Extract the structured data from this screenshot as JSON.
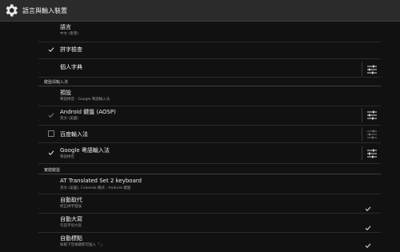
{
  "titlebar": {
    "title": "語言與輸入裝置"
  },
  "items": {
    "language": {
      "title": "語言",
      "subtitle": "中文 (香港)"
    },
    "spell": {
      "title": "拼字檢查"
    },
    "dict": {
      "title": "個人字典"
    },
    "default": {
      "title": "預設",
      "subtitle": "粵語拼音 - Google 粵語輸入法"
    },
    "aosp": {
      "title": "Android 鍵盤 (AOSP)",
      "subtitle": "英文 (美國)"
    },
    "baidu": {
      "title": "百度輸入法"
    },
    "google": {
      "title": "Google 粵語輸入法",
      "subtitle": "粵語拼音"
    },
    "at": {
      "title": "AT Translated Set 2 keyboard",
      "subtitle": "英文 (美國), Colemak 模式 - Android 鍵盤"
    },
    "autoreplace": {
      "title": "自動取代",
      "subtitle": "修正拼字錯誤"
    },
    "autocap": {
      "title": "自動大寫",
      "subtitle": "句首字母大寫"
    },
    "autopunct": {
      "title": "自動標點",
      "subtitle": "按兩下空格鍵即可插入「.」"
    }
  },
  "sections": {
    "keyboard": "鍵盤與輸入法",
    "physical": "實體鍵盤"
  },
  "colors": {
    "accent": "#ffffff",
    "check": "#d9d9d9",
    "disabled": "#6e6e6e"
  }
}
